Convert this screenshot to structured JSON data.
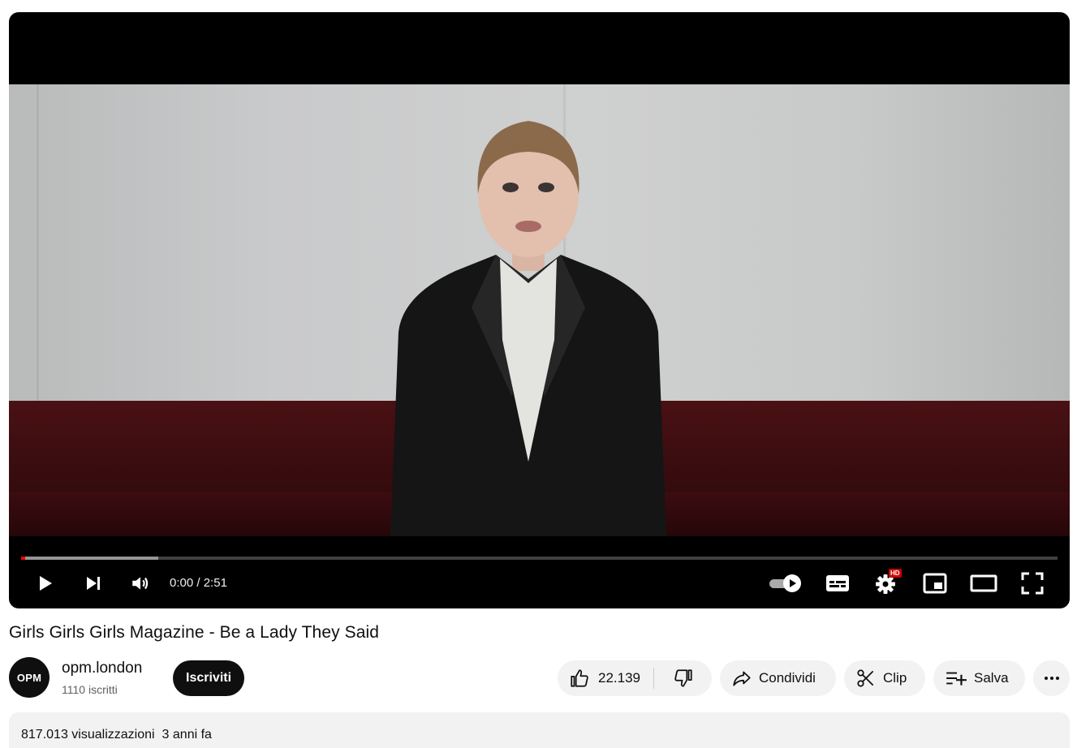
{
  "player": {
    "time_current": "0:00",
    "time_separator": " / ",
    "time_duration": "2:51",
    "progress_played_fraction": 0.002,
    "progress_buffered_fraction": 0.132,
    "quality_badge": "HD",
    "autoplay_on": true
  },
  "video": {
    "title": "Girls Girls Girls Magazine - Be a Lady They Said"
  },
  "channel": {
    "avatar_text": "OPM",
    "name": "opm.london",
    "subscribers": "1110 iscritti",
    "subscribe_label": "Iscriviti"
  },
  "actions": {
    "like_count": "22.139",
    "share_label": "Condividi",
    "clip_label": "Clip",
    "save_label": "Salva"
  },
  "description": {
    "views": "817.013 visualizzazioni",
    "date": "3 anni fa"
  },
  "colors": {
    "progress_played": "#ff0000",
    "hd_badge": "#cc0000",
    "subscribe_bg": "#0f0f0f",
    "pill_bg": "#f2f2f2"
  },
  "icons": {
    "play": "play-icon",
    "next": "next-icon",
    "volume": "volume-icon",
    "autoplay": "autoplay-toggle-icon",
    "subtitles": "subtitles-icon",
    "settings": "settings-gear-icon",
    "miniplayer": "miniplayer-icon",
    "theater": "theater-mode-icon",
    "fullscreen": "fullscreen-icon",
    "like": "thumbs-up-icon",
    "dislike": "thumbs-down-icon",
    "share": "share-arrow-icon",
    "clip": "scissors-icon",
    "save": "playlist-add-icon",
    "more": "more-horizontal-icon"
  }
}
